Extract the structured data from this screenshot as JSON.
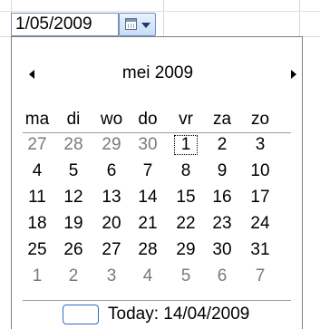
{
  "date_field": {
    "value": "1/05/2009"
  },
  "calendar": {
    "month_title": "mei 2009",
    "weekdays": [
      "ma",
      "di",
      "wo",
      "do",
      "vr",
      "za",
      "zo"
    ],
    "weeks": [
      [
        {
          "d": "27",
          "dim": true
        },
        {
          "d": "28",
          "dim": true
        },
        {
          "d": "29",
          "dim": true
        },
        {
          "d": "30",
          "dim": true
        },
        {
          "d": "1",
          "selected": true
        },
        {
          "d": "2"
        },
        {
          "d": "3"
        }
      ],
      [
        {
          "d": "4"
        },
        {
          "d": "5"
        },
        {
          "d": "6"
        },
        {
          "d": "7"
        },
        {
          "d": "8"
        },
        {
          "d": "9"
        },
        {
          "d": "10"
        }
      ],
      [
        {
          "d": "11"
        },
        {
          "d": "12"
        },
        {
          "d": "13"
        },
        {
          "d": "14"
        },
        {
          "d": "15"
        },
        {
          "d": "16"
        },
        {
          "d": "17"
        }
      ],
      [
        {
          "d": "18"
        },
        {
          "d": "19"
        },
        {
          "d": "20"
        },
        {
          "d": "21"
        },
        {
          "d": "22"
        },
        {
          "d": "23"
        },
        {
          "d": "24"
        }
      ],
      [
        {
          "d": "25"
        },
        {
          "d": "26"
        },
        {
          "d": "27"
        },
        {
          "d": "28"
        },
        {
          "d": "29"
        },
        {
          "d": "30"
        },
        {
          "d": "31"
        }
      ],
      [
        {
          "d": "1",
          "dim": true
        },
        {
          "d": "2",
          "dim": true
        },
        {
          "d": "3",
          "dim": true
        },
        {
          "d": "4",
          "dim": true
        },
        {
          "d": "5",
          "dim": true
        },
        {
          "d": "6",
          "dim": true
        },
        {
          "d": "7",
          "dim": true
        }
      ]
    ],
    "today_label": "Today: 14/04/2009"
  },
  "icons": {
    "prev": "triangle-left-icon",
    "next": "triangle-right-icon",
    "calendar": "calendar-icon",
    "dropdown": "chevron-down-icon"
  },
  "colors": {
    "today_box": "#2a6fbf",
    "dim_text": "#7a7a7a",
    "button_border": "#6f8fc2"
  }
}
